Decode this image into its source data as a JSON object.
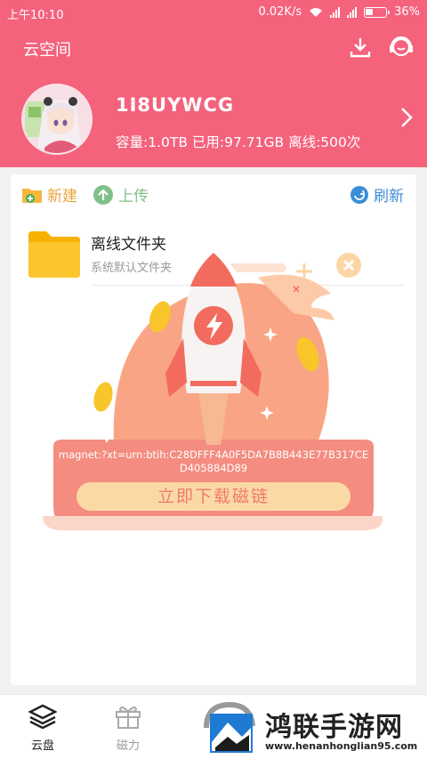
{
  "status_bar": {
    "time": "上午10:10",
    "speed": "0.02K/s",
    "battery": "36%",
    "battery_level": 0.36
  },
  "header": {
    "title": "云空间",
    "username": "1I8UYWCG",
    "quota": "容量:1.0TB 已用:97.71GB 离线:500次"
  },
  "toolbar": {
    "new_label": "新建",
    "upload_label": "上传",
    "refresh_label": "刷新"
  },
  "folder": {
    "name": "离线文件夹",
    "subtitle": "系统默认文件夹"
  },
  "promo": {
    "magnet_text": "magnet:?xt=urn:btih:C28DFFF4A0F5DA7B8B443E77B317CED405884D89",
    "button_label": "立即下载磁链"
  },
  "bottom_nav": {
    "items": [
      {
        "label": "云盘"
      },
      {
        "label": "磁力"
      }
    ]
  },
  "watermark": {
    "text": "鸿联手游网",
    "url": "www.henanhonglian95.com"
  },
  "colors": {
    "brand": "#f4627c",
    "folder": "#fbc02d",
    "promo_peach": "#f9a585"
  },
  "icons": [
    "download-icon",
    "headset-icon",
    "chevron-right-icon",
    "new-folder-icon",
    "upload-icon",
    "refresh-icon",
    "folder-icon",
    "close-icon",
    "rocket-icon",
    "cloud-disk-icon",
    "gift-icon"
  ]
}
